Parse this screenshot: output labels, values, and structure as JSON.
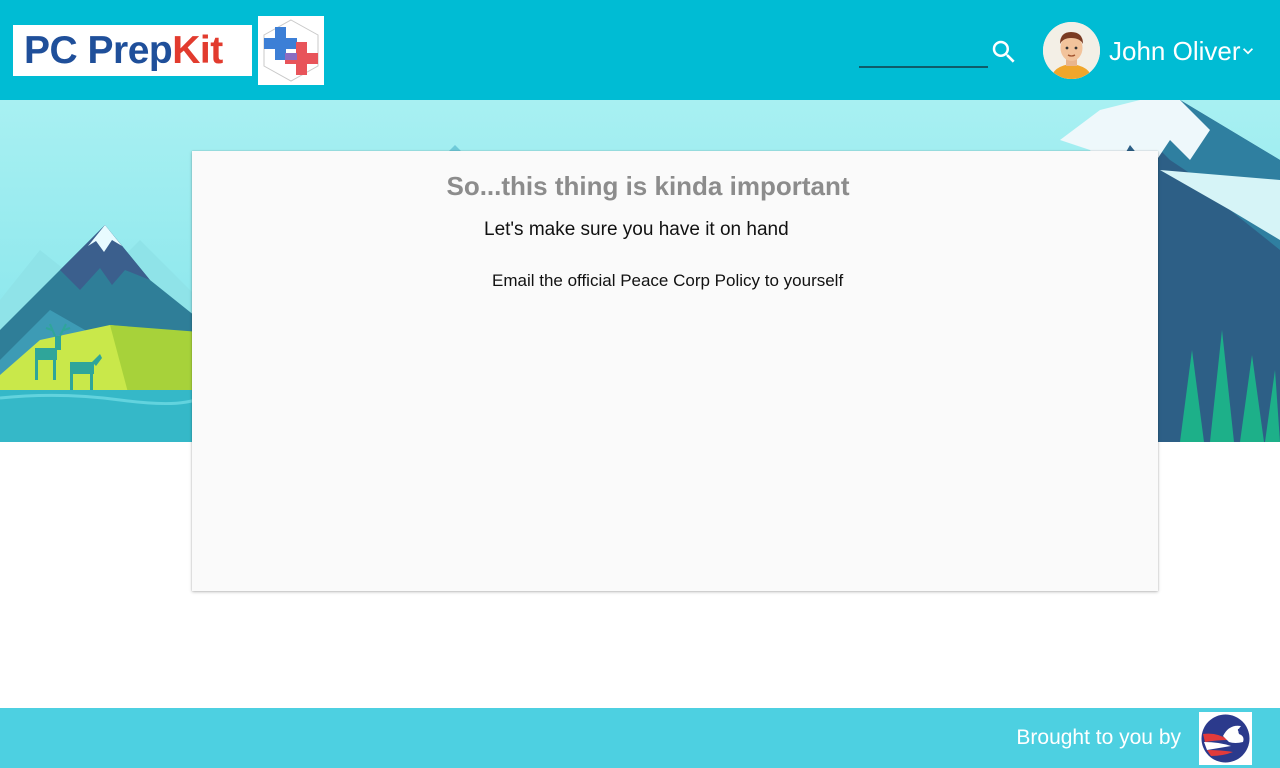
{
  "header": {
    "logo_part1": "PC Prep",
    "logo_part2": "Kit",
    "logo_badge_icon": "medical-cross-badge-icon",
    "search": {
      "value": "",
      "placeholder": "",
      "icon": "search-icon"
    },
    "user": {
      "name": "John Oliver",
      "avatar_icon": "user-avatar",
      "menu_icon": "chevron-down-icon"
    },
    "background_color": "#00bcd4"
  },
  "card": {
    "title": "So...this thing is kinda important",
    "subtitle": "Let's make sure you have it on hand",
    "email_link": "Email the official Peace Corp Policy to yourself"
  },
  "footer": {
    "text": "Brought to you by",
    "logo_icon": "peace-corps-dove-icon",
    "background_color": "#4dd0e1"
  }
}
